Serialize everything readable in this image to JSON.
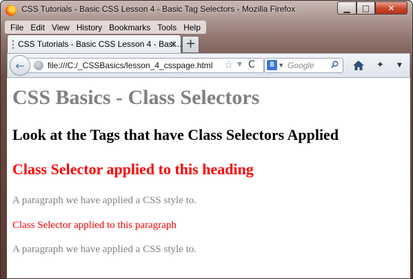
{
  "window": {
    "title": "CSS Tutorials - Basic CSS Lesson 4 - Basic Tag Selectors - Mozilla Firefox",
    "controls": {
      "minimize": "▁",
      "maximize": "□",
      "close": "✕"
    }
  },
  "menubar": {
    "items": [
      {
        "label": "File"
      },
      {
        "label": "Edit"
      },
      {
        "label": "View"
      },
      {
        "label": "History"
      },
      {
        "label": "Bookmarks"
      },
      {
        "label": "Tools"
      },
      {
        "label": "Help"
      }
    ]
  },
  "tabs": [
    {
      "title": "CSS Tutorials - Basic CSS Lesson 4 - Basi...",
      "close": "×"
    }
  ],
  "new_tab": "+",
  "navbar": {
    "back": "←",
    "url": "file:///C:/_CSSBasics/lesson_4_csspage.html",
    "bookmark_star": "☆",
    "history_dropmarker": "▼",
    "reload": "C",
    "search_engine_letter": "8",
    "search_engine_drop": "▼",
    "search_placeholder": "Google",
    "addon_glyph": "✦",
    "menu_drop": "▼"
  },
  "page": {
    "title": "CSS Basics - Class Selectors",
    "subheading": "Look at the Tags that have Class Selectors Applied",
    "class_heading": "Class Selector applied to this heading",
    "paragraphs": [
      {
        "text": "A paragraph we have applied a CSS style to.",
        "style": "gray"
      },
      {
        "text": "Class Selector applied to this paragraph",
        "style": "red"
      },
      {
        "text": "A paragraph we have applied a CSS style to.",
        "style": "gray"
      }
    ]
  },
  "colors": {
    "page_title": "#808080",
    "class_selector": "#ff0000",
    "paragraph": "#808080",
    "subheading": "#000000"
  },
  "icons": [
    "firefox-icon",
    "page-icon",
    "globe-icon",
    "star-icon",
    "reload-icon",
    "google-icon",
    "magnifier-icon",
    "home-icon",
    "addon-icon"
  ]
}
